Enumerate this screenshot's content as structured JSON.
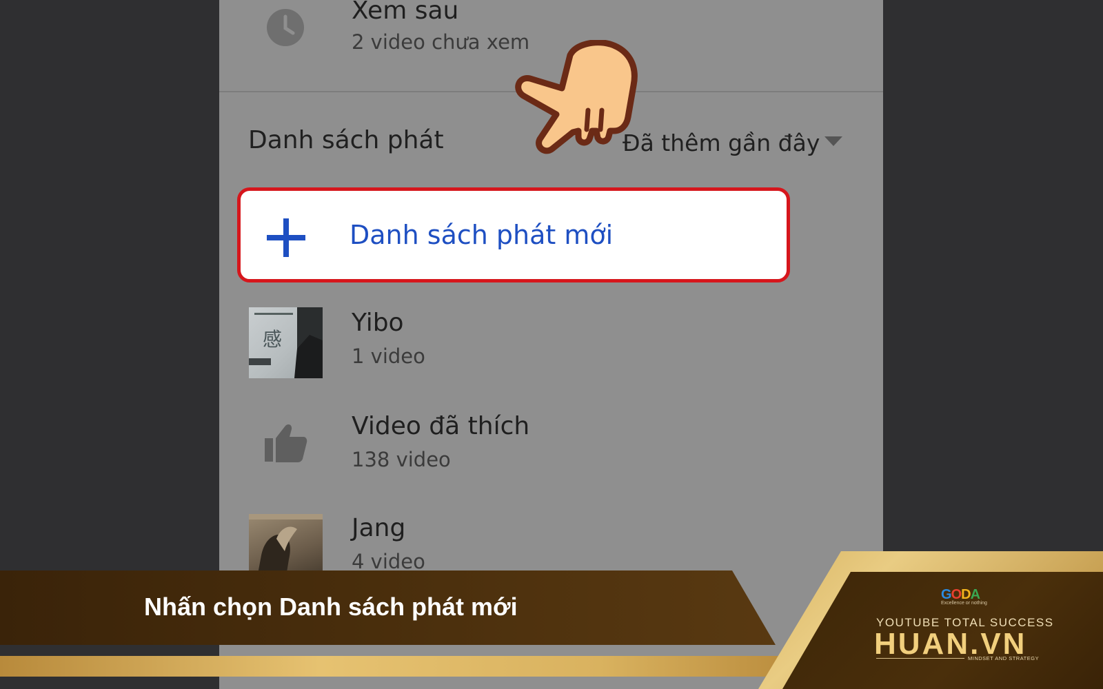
{
  "watch_later": {
    "title": "Xem sau",
    "subtitle": "2 video chưa xem",
    "icon": "clock-icon"
  },
  "playlists_header": {
    "label": "Danh sách phát",
    "sort_label": "Đã thêm gần đây",
    "sort_icon": "caret-down-icon"
  },
  "new_playlist": {
    "label": "Danh sách phát mới",
    "icon": "plus-icon",
    "highlight_color": "#d6161c",
    "text_color": "#1e4fc2"
  },
  "playlists": [
    {
      "title": "Yibo",
      "count": "1 video",
      "thumb": "image"
    },
    {
      "title": "Video đã thích",
      "count": "138 video",
      "thumb": "thumbs-up-icon"
    },
    {
      "title": "Jang",
      "count": "4 video",
      "thumb": "image"
    }
  ],
  "pointer": {
    "icon": "pointing-hand-icon"
  },
  "banner": {
    "caption": "Nhấn chọn Danh sách phát mới",
    "brand_logo": "GODA",
    "brand_tagline": "Excellence or nothing",
    "brand_top": "YOUTUBE TOTAL SUCCESS",
    "brand_main": "HUAN.VN",
    "brand_sub": "MINDSET AND STRATEGY"
  }
}
